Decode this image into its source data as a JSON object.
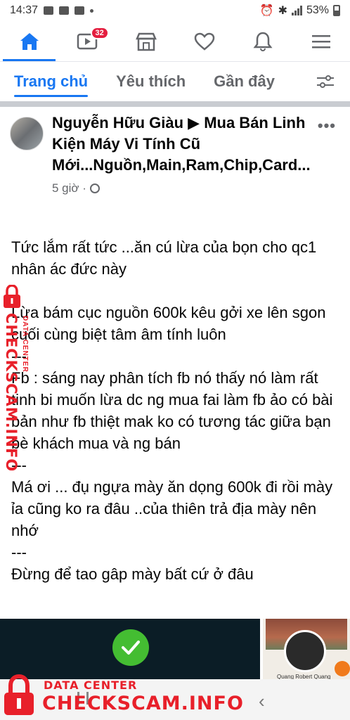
{
  "status_bar": {
    "time": "14:37",
    "battery": "53%",
    "icons": [
      "image-icon",
      "messenger-icon",
      "mail-icon",
      "alarm-icon",
      "bluetooth-icon",
      "4g-icon",
      "signal-icon",
      "battery-icon"
    ]
  },
  "top_nav": {
    "items": [
      {
        "name": "home-icon",
        "active": true
      },
      {
        "name": "watch-icon",
        "badge": "32"
      },
      {
        "name": "marketplace-icon"
      },
      {
        "name": "dating-icon"
      },
      {
        "name": "notifications-icon"
      },
      {
        "name": "menu-icon"
      }
    ],
    "accent": "#1877f2"
  },
  "feed_tabs": {
    "home": "Trang chủ",
    "favorites": "Yêu thích",
    "recent": "Gần đây"
  },
  "post": {
    "author": "Nguyễn Hữu Giàu ▶ Mua Bán Linh Kiện Máy Vi Tính Cũ Mới...Nguồn,Main,Ram,Chip,Card...",
    "time": "5 giờ ·",
    "paragraphs": [
      "Tức lắm rất tức ...ăn cú lừa của bọn cho qc1 nhân ác đức này",
      "Lừa bám cục nguồn 600k kêu gởi xe lên sgon cuối cùng biệt tâm âm tính luôn",
      "---",
      "Fb : sáng nay phân tích fb nó thấy nó làm rất tinh bi muốn lừa dc ng mua fai làm fb ảo có bài bản như fb thiệt mak ko có tương tác giữa bạn bè khách mua và ng bán",
      "---",
      "Má ơi ... đụ ngựa mày ăn dọng 600k đi rồi mày ỉa cũng ko ra đâu ..của thiên trả địa mày nên nhớ",
      "---",
      "Đừng để tao gâp mày bất cứ ở đâu"
    ]
  },
  "thumbnail": {
    "name": "Quang Robert Quang"
  },
  "watermark": {
    "label_small": "DATA CENTER",
    "site": "CHECKSCAM.INFO",
    "color": "#e8202a"
  }
}
